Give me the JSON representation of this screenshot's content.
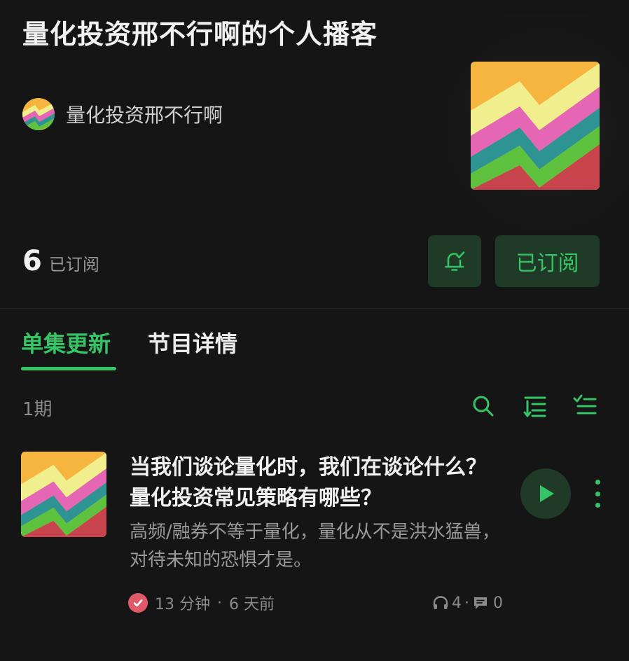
{
  "podcast": {
    "title": "量化投资邢不行啊的个人播客",
    "author": "量化投资邢不行啊",
    "subscriber_count": "6",
    "subscriber_label": "已订阅",
    "subscribe_button": "已订阅"
  },
  "tabs": [
    {
      "label": "单集更新",
      "active": true
    },
    {
      "label": "节目详情",
      "active": false
    }
  ],
  "episode_count": "1期",
  "toolbar_icons": [
    "search-icon",
    "sort-icon",
    "multi-select-icon"
  ],
  "episode": {
    "title": "当我们谈论量化时，我们在谈论什么？量化投资常见策略有哪些？",
    "description": "高频/融券不等于量化，量化从不是洪水猛兽，对待未知的恐惧才是。",
    "duration": "13 分钟",
    "separator": "·",
    "published": "6 天前",
    "listens": "4",
    "stats_separator": "·",
    "comments": "0"
  },
  "colors": {
    "background": "#151515",
    "accent": "#36c566",
    "button_bg": "#1f3a27",
    "check_badge": "#e05a6a",
    "cover_stripes": [
      "#f5b53f",
      "#f1ee8e",
      "#e466b4",
      "#2e9493",
      "#5fc23f",
      "#c8444c"
    ]
  }
}
